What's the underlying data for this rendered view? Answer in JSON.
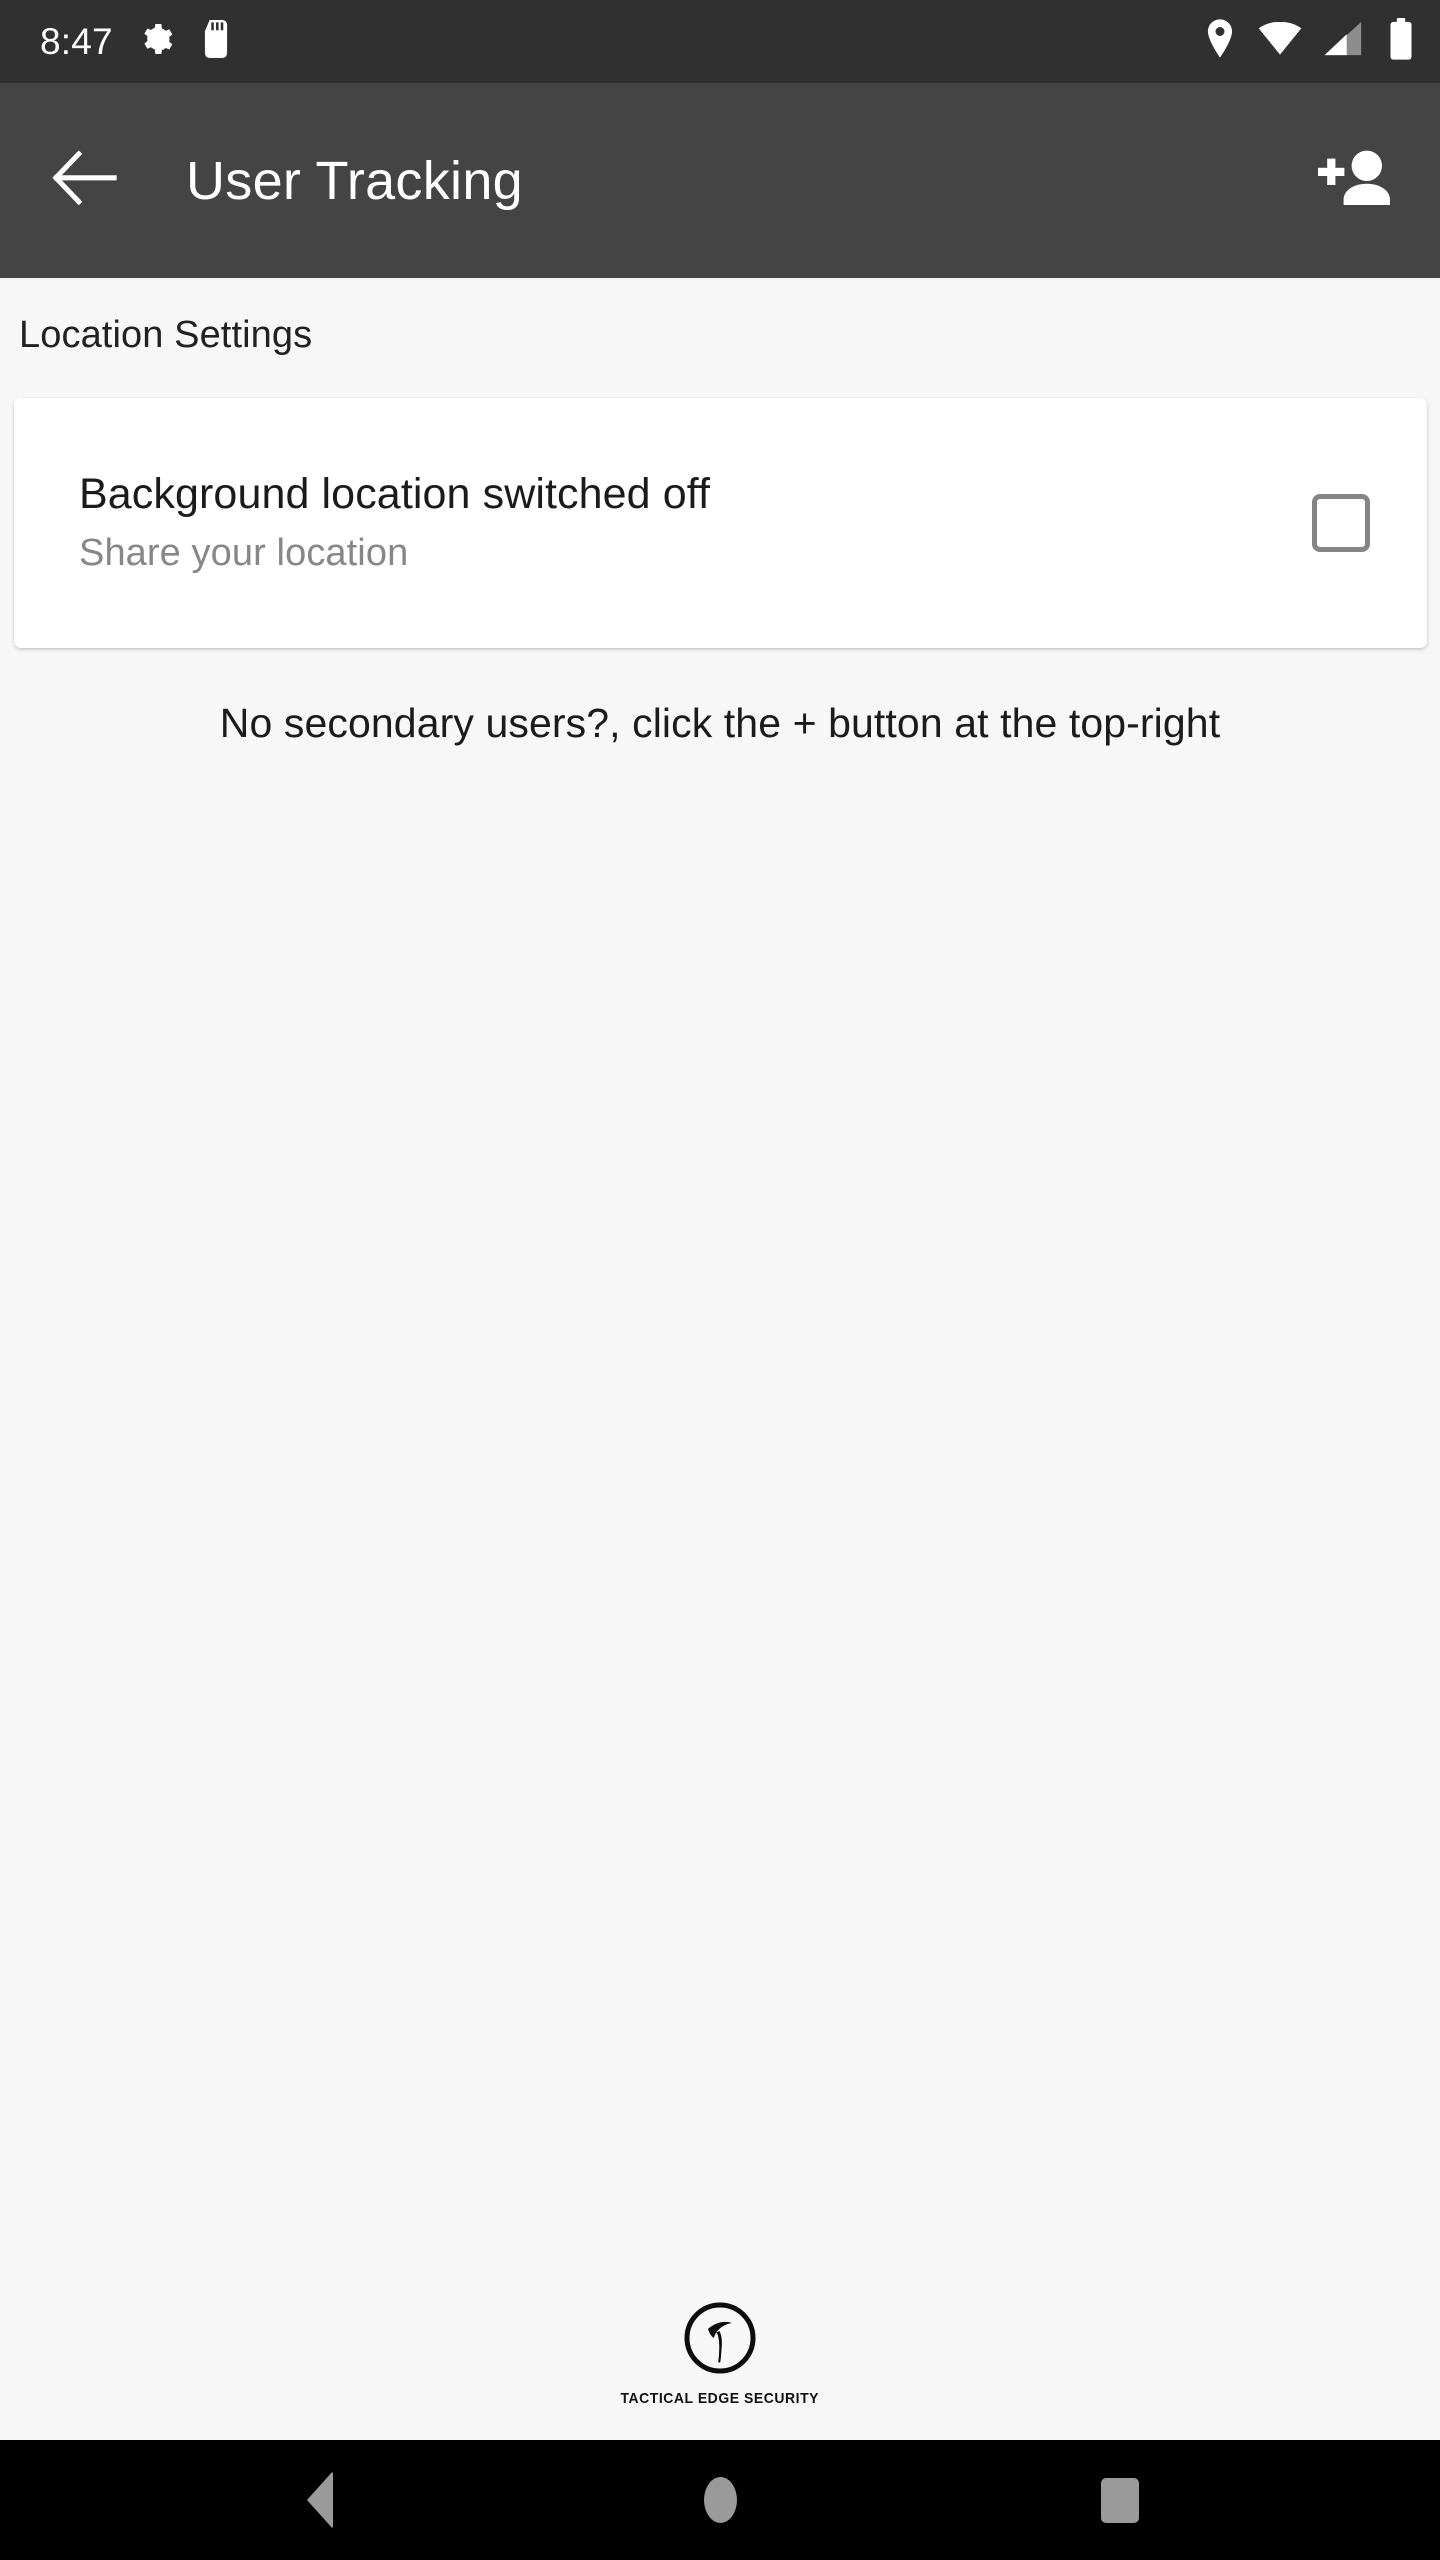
{
  "status_bar": {
    "clock": "8:47",
    "left_icons": [
      "gear-icon",
      "sd-card-icon"
    ],
    "right_icons": [
      "location-pin-icon",
      "wifi-icon",
      "cellular-signal-icon",
      "battery-icon"
    ],
    "background_color": "#303030",
    "foreground_color": "#ffffff"
  },
  "app_bar": {
    "back_label": "back-arrow",
    "title": "User Tracking",
    "action_label": "person-add",
    "background_color": "#444444",
    "foreground_color": "#ffffff"
  },
  "content": {
    "section_header": "Location Settings",
    "location_card": {
      "title": "Background location switched off",
      "subtitle": "Share your location",
      "checkbox_checked": false
    },
    "empty_state_message": "No secondary users?, click the + button at the top-right",
    "background_color": "#f7f7f7"
  },
  "footer": {
    "logo_name": "tactical-edge-security-logo",
    "wordmark": "TACTICAL EDGE SECURITY"
  },
  "nav_bar": {
    "buttons": [
      "back",
      "home",
      "recents"
    ],
    "background_color": "#000000",
    "icon_color": "#9a9a9a"
  }
}
